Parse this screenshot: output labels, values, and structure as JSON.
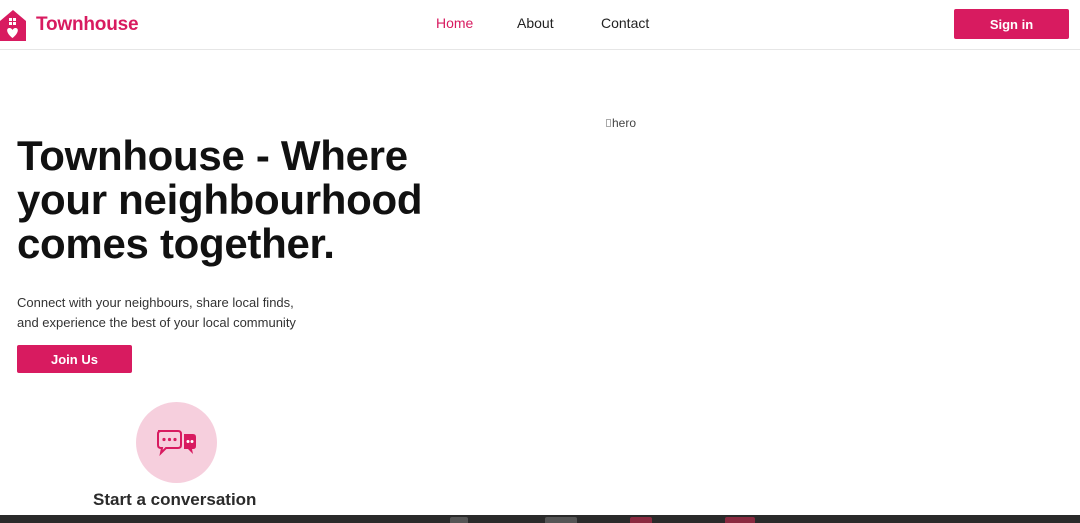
{
  "brand": {
    "name": "Townhouse",
    "color": "#d81b60",
    "logo_icon": "house-heart-icon"
  },
  "nav": {
    "items": [
      {
        "label": "Home",
        "active": true
      },
      {
        "label": "About",
        "active": false
      },
      {
        "label": "Contact",
        "active": false
      }
    ],
    "signin_label": "Sign in"
  },
  "hero": {
    "title": "Townhouse - Where your neighbourhood comes together.",
    "subtitle_line1": "Connect with your neighbours, share local finds,",
    "subtitle_line2": "and experience the best of your local community",
    "cta_label": "Join Us",
    "image_alt": "hero"
  },
  "features": [
    {
      "title": "Start a conversation",
      "icon": "chat-bubbles-icon"
    }
  ],
  "colors": {
    "accent": "#d81b60",
    "accent_light": "#f6cfdd"
  }
}
